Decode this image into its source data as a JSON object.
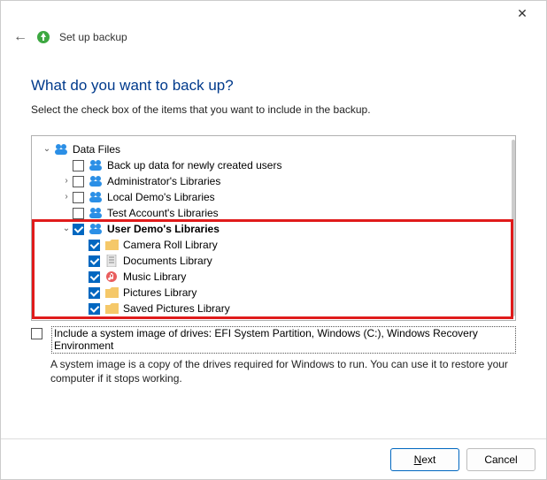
{
  "window": {
    "title": "Set up backup"
  },
  "page": {
    "heading": "What do you want to back up?",
    "description": "Select the check box of the items that you want to include in the backup."
  },
  "tree": {
    "root": {
      "label": "Data Files",
      "checked": false,
      "expanded": true
    },
    "items": [
      {
        "label": "Back up data for newly created users",
        "checked": false,
        "expand": null
      },
      {
        "label": "Administrator's Libraries",
        "checked": false,
        "expand": "closed"
      },
      {
        "label": "Local Demo's Libraries",
        "checked": false,
        "expand": "closed"
      },
      {
        "label": "Test Account's Libraries",
        "checked": false,
        "expand": null
      },
      {
        "label": "User Demo's Libraries",
        "checked": true,
        "expand": "open",
        "bold": true
      }
    ],
    "userDemoChildren": [
      {
        "label": "Camera Roll Library",
        "checked": true,
        "icon": "folder"
      },
      {
        "label": "Documents Library",
        "checked": true,
        "icon": "doc"
      },
      {
        "label": "Music Library",
        "checked": true,
        "icon": "music"
      },
      {
        "label": "Pictures Library",
        "checked": true,
        "icon": "folder"
      },
      {
        "label": "Saved Pictures Library",
        "checked": true,
        "icon": "folder"
      }
    ]
  },
  "systemImage": {
    "checked": false,
    "label": "Include a system image of drives: EFI System Partition, Windows (C:), Windows Recovery Environment",
    "description": "A system image is a copy of the drives required for Windows to run. You can use it to restore your computer if it stops working."
  },
  "buttons": {
    "next": "Next",
    "cancel": "Cancel"
  }
}
